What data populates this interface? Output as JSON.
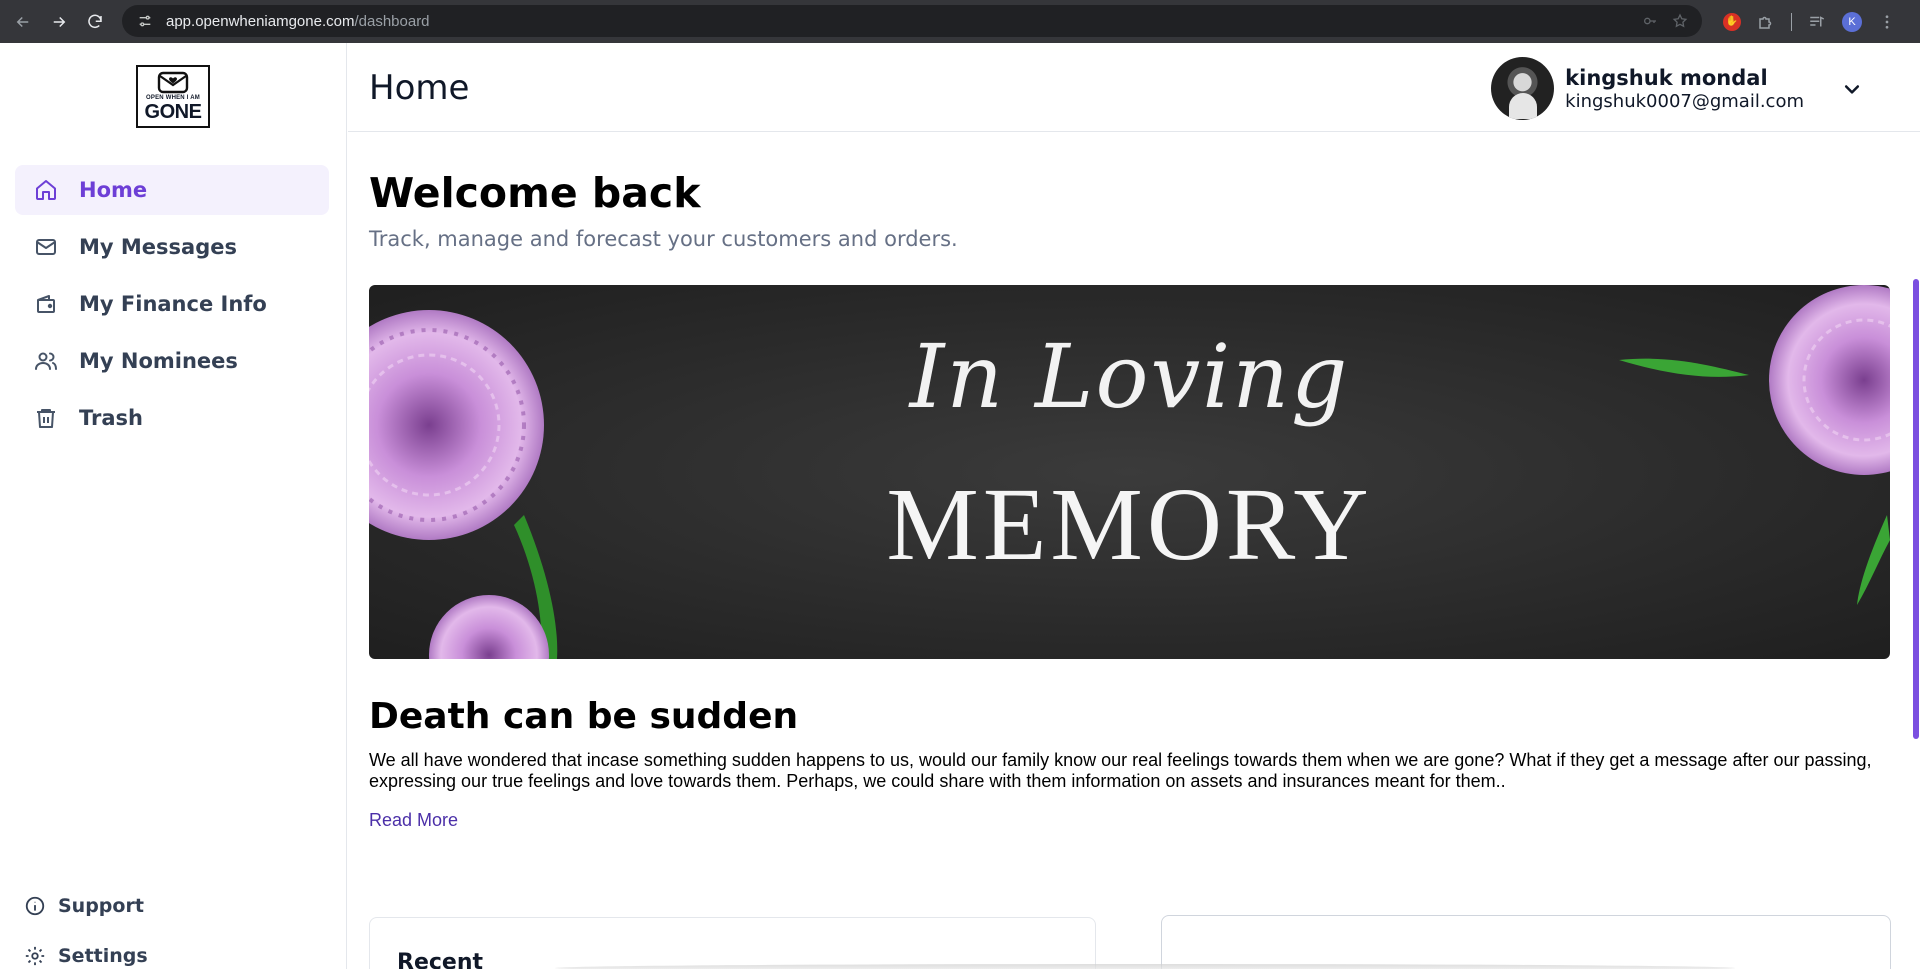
{
  "browser": {
    "url_host": "app.openwheniamgone.com",
    "url_path": "/dashboard",
    "profile_initial": "K"
  },
  "logo": {
    "line1": "OPEN WHEN I AM",
    "line2": "GONE"
  },
  "sidebar": {
    "items": [
      {
        "label": "Home",
        "icon": "home-icon",
        "active": true
      },
      {
        "label": "My Messages",
        "icon": "mail-icon",
        "active": false
      },
      {
        "label": "My Finance Info",
        "icon": "wallet-icon",
        "active": false
      },
      {
        "label": "My Nominees",
        "icon": "users-icon",
        "active": false
      },
      {
        "label": "Trash",
        "icon": "trash-icon",
        "active": false
      }
    ],
    "bottom": [
      {
        "label": "Support",
        "icon": "info-icon"
      },
      {
        "label": "Settings",
        "icon": "gear-icon"
      }
    ]
  },
  "header": {
    "title": "Home",
    "user_name": "kingshuk mondal",
    "user_email": "kingshuk0007@gmail.com"
  },
  "main": {
    "welcome": "Welcome back",
    "subtitle": "Track, manage and forecast your customers and orders.",
    "banner_script": "In Loving",
    "banner_big": "MEMORY",
    "section_title": "Death can be sudden",
    "section_text": "We all have wondered that incase something sudden happens to us, would our family know our real feelings towards them when we are gone? What if they get a message after our passing, expressing our true feelings and love towards them. Perhaps, we could share with them information on assets and insurances meant for them..",
    "read_more": "Read More",
    "card_left_title": "Recent"
  },
  "colors": {
    "accent": "#6d3fd6",
    "active_bg": "#f4f1fd",
    "link": "#4b2fa8"
  }
}
